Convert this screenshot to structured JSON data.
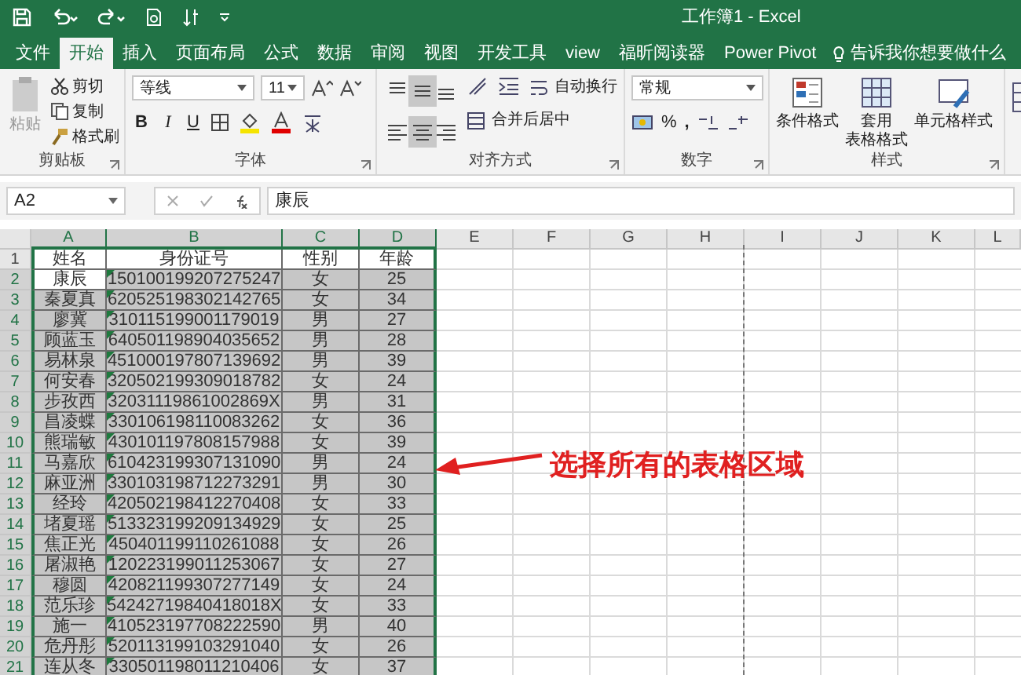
{
  "window": {
    "title": "工作簿1  -  Excel"
  },
  "tabs": [
    {
      "label": "文件",
      "selected": false
    },
    {
      "label": "开始",
      "selected": true
    },
    {
      "label": "插入",
      "selected": false
    },
    {
      "label": "页面布局",
      "selected": false
    },
    {
      "label": "公式",
      "selected": false
    },
    {
      "label": "数据",
      "selected": false
    },
    {
      "label": "审阅",
      "selected": false
    },
    {
      "label": "视图",
      "selected": false
    },
    {
      "label": "开发工具",
      "selected": false
    },
    {
      "label": "view",
      "selected": false
    },
    {
      "label": "福昕阅读器",
      "selected": false
    },
    {
      "label": "Power Pivot",
      "selected": false
    }
  ],
  "tell_me": {
    "placeholder": "告诉我你想要做什么"
  },
  "ribbon": {
    "clipboard": {
      "paste": "粘贴",
      "cut": "剪切",
      "copy": "复制",
      "format_painter": "格式刷",
      "label": "剪贴板"
    },
    "font": {
      "name": "等线",
      "size": "11",
      "bold": "B",
      "italic": "I",
      "underline": "U",
      "label": "字体"
    },
    "alignment": {
      "buttons": [
        {
          "kind": "top",
          "selected": false
        },
        {
          "kind": "middle",
          "selected": true
        },
        {
          "kind": "bottom",
          "selected": false
        },
        {
          "kind": "left",
          "selected": false
        },
        {
          "kind": "center",
          "selected": true
        },
        {
          "kind": "right",
          "selected": false
        }
      ],
      "wrap": "自动换行",
      "merge": "合并后居中",
      "label": "对齐方式"
    },
    "number": {
      "format": "常规",
      "percent": "%",
      "comma": ",",
      "label": "数字"
    },
    "styles": {
      "conditional": "条件格式",
      "table_line1": "套用",
      "table_line2": "表格格式",
      "cell_styles": "单元格样式",
      "label": "样式"
    }
  },
  "formula_bar": {
    "name_box": "A2",
    "value": "康辰"
  },
  "columns": [
    "A",
    "B",
    "C",
    "D",
    "E",
    "F",
    "G",
    "H",
    "I",
    "J",
    "K",
    "L"
  ],
  "header_row": {
    "number": "1",
    "cells": [
      "姓名",
      "身份证号",
      "性别",
      "年龄"
    ]
  },
  "rows": [
    {
      "number": "2",
      "cells": [
        "康辰",
        "150100199207275247",
        "女",
        "25"
      ],
      "selected": true,
      "active": true
    },
    {
      "number": "3",
      "cells": [
        "秦夏真",
        "620525198302142765",
        "女",
        "34"
      ],
      "selected": true,
      "active": false
    },
    {
      "number": "4",
      "cells": [
        "廖冀",
        "310115199001179019",
        "男",
        "27"
      ],
      "selected": true,
      "active": false
    },
    {
      "number": "5",
      "cells": [
        "顾蓝玉",
        "640501198904035652",
        "男",
        "28"
      ],
      "selected": true,
      "active": false
    },
    {
      "number": "6",
      "cells": [
        "易林泉",
        "451000197807139692",
        "男",
        "39"
      ],
      "selected": true,
      "active": false
    },
    {
      "number": "7",
      "cells": [
        "何安春",
        "320502199309018782",
        "女",
        "24"
      ],
      "selected": true,
      "active": false
    },
    {
      "number": "8",
      "cells": [
        "步孜西",
        "32031119861002869X",
        "男",
        "31"
      ],
      "selected": true,
      "active": false
    },
    {
      "number": "9",
      "cells": [
        "昌凌蝶",
        "330106198110083262",
        "女",
        "36"
      ],
      "selected": true,
      "active": false
    },
    {
      "number": "10",
      "cells": [
        "熊瑞敏",
        "430101197808157988",
        "女",
        "39"
      ],
      "selected": true,
      "active": false
    },
    {
      "number": "11",
      "cells": [
        "马嘉欣",
        "610423199307131090",
        "男",
        "24"
      ],
      "selected": true,
      "active": false
    },
    {
      "number": "12",
      "cells": [
        "麻亚洲",
        "330103198712273291",
        "男",
        "30"
      ],
      "selected": true,
      "active": false
    },
    {
      "number": "13",
      "cells": [
        "经玲",
        "420502198412270408",
        "女",
        "33"
      ],
      "selected": true,
      "active": false
    },
    {
      "number": "14",
      "cells": [
        "堵夏瑶",
        "513323199209134929",
        "女",
        "25"
      ],
      "selected": true,
      "active": false
    },
    {
      "number": "15",
      "cells": [
        "焦正光",
        "450401199110261088",
        "女",
        "26"
      ],
      "selected": true,
      "active": false
    },
    {
      "number": "16",
      "cells": [
        "屠淑艳",
        "120223199011253067",
        "女",
        "27"
      ],
      "selected": true,
      "active": false
    },
    {
      "number": "17",
      "cells": [
        "穆圆",
        "420821199307277149",
        "女",
        "24"
      ],
      "selected": true,
      "active": false
    },
    {
      "number": "18",
      "cells": [
        "范乐珍",
        "54242719840418018X",
        "女",
        "33"
      ],
      "selected": true,
      "active": false
    },
    {
      "number": "19",
      "cells": [
        "施一",
        "410523197708222590",
        "男",
        "40"
      ],
      "selected": true,
      "active": false
    },
    {
      "number": "20",
      "cells": [
        "危丹彤",
        "520113199103291040",
        "女",
        "26"
      ],
      "selected": true,
      "active": false
    },
    {
      "number": "21",
      "cells": [
        "连从冬",
        "330501198011210406",
        "女",
        "37"
      ],
      "selected": true,
      "active": false
    }
  ],
  "annotation": {
    "text": "选择所有的表格区域"
  }
}
